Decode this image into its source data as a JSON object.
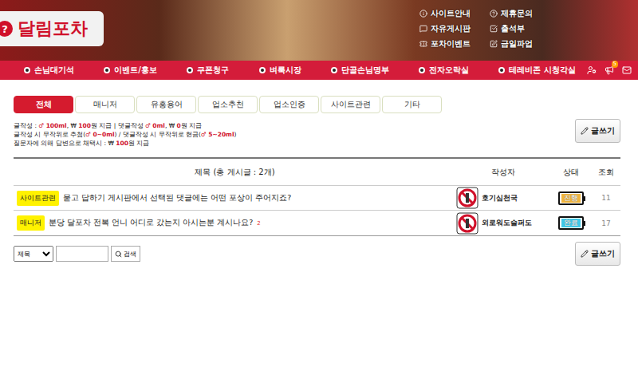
{
  "header": {
    "logo_icon": "?",
    "logo": "달림포차",
    "links": [
      "사이트안내",
      "제휴문의",
      "자유게시판",
      "출석부",
      "포차이벤트",
      "금일파업"
    ]
  },
  "nav": {
    "items": [
      "손님대기석",
      "이벤트/홍보",
      "쿠폰청구",
      "벼룩시장",
      "단골손님명부",
      "전자오락실",
      "테레비존 시청각실"
    ],
    "badge": "5"
  },
  "categories": [
    {
      "label": "전체",
      "selected": true
    },
    {
      "label": "매니저",
      "selected": false
    },
    {
      "label": "유흥용어",
      "selected": false
    },
    {
      "label": "업소추천",
      "selected": false
    },
    {
      "label": "업소인증",
      "selected": false
    },
    {
      "label": "사이트관련",
      "selected": false
    },
    {
      "label": "기타",
      "selected": false
    }
  ],
  "info": [
    [
      {
        "text": "글작성 : ",
        "highlight": false
      },
      {
        "text": "♂ 100ml",
        "highlight": true
      },
      {
        "text": ", ₩ ",
        "highlight": false
      },
      {
        "text": "100",
        "highlight": true
      },
      {
        "text": "원 지급 | 댓글작성 ",
        "highlight": false
      },
      {
        "text": "♂ 0ml",
        "highlight": true
      },
      {
        "text": ", ₩ ",
        "highlight": false
      },
      {
        "text": "0",
        "highlight": true
      },
      {
        "text": "원 지급",
        "highlight": false
      }
    ],
    [
      {
        "text": "글작성 시 무작위로 추첨(",
        "highlight": false
      },
      {
        "text": "♂ 0~0ml",
        "highlight": true
      },
      {
        "text": ") / 댓글작성 시 무작위로 현금(",
        "highlight": false
      },
      {
        "text": "♂ 5~20ml",
        "highlight": true
      },
      {
        "text": ")",
        "highlight": false
      }
    ],
    [
      {
        "text": "질문자에 의해 답변으로 채택시 : ₩ ",
        "highlight": false
      },
      {
        "text": "100",
        "highlight": true
      },
      {
        "text": "원 지급",
        "highlight": false
      }
    ]
  ],
  "write_button": "글쓰기",
  "table": {
    "columns": [
      "제목 (총 게시글 : 2개)",
      "작성자",
      "상태",
      "조회"
    ],
    "rows": [
      {
        "category": "사이트관련",
        "title": "묻고 답하기 게시판에서 선택된 댓글에는 어떤 포상이 주어지죠?",
        "comments": "",
        "author": "호기심천국",
        "status": "진행",
        "status_color": "#f0b43c",
        "views": "11"
      },
      {
        "category": "매니저",
        "title": "분당 달포차 전복 언니 어디로 갔는지 아시는분 계시나요?",
        "comments": "2",
        "author": "외로워도슬퍼도",
        "status": "완료",
        "status_color": "#3fc8e8",
        "views": "17"
      }
    ]
  },
  "search": {
    "field": "제목",
    "value": "",
    "button": "검색"
  }
}
